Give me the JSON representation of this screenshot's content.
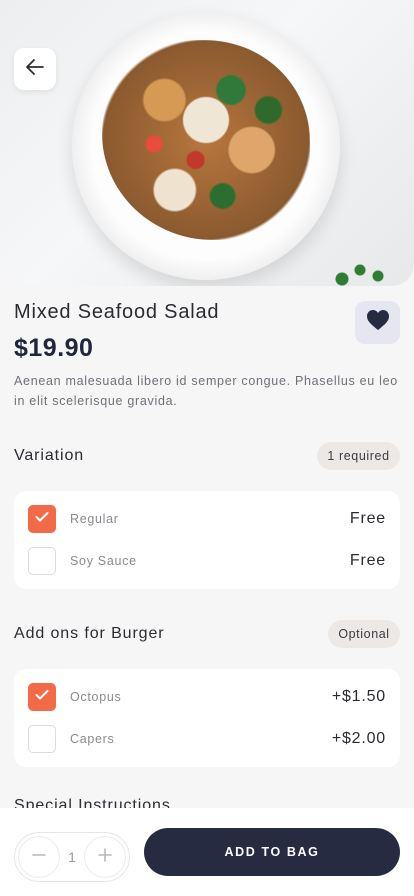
{
  "product": {
    "title": "Mixed Seafood Salad",
    "price": "$19.90",
    "description": "Aenean malesuada libero id semper congue. Phasellus eu leo in elit scelerisque gravida."
  },
  "variation": {
    "title": "Variation",
    "badge": "1 required",
    "options": [
      {
        "label": "Regular",
        "price": "Free",
        "checked": true
      },
      {
        "label": "Soy Sauce",
        "price": "Free",
        "checked": false
      }
    ]
  },
  "addons": {
    "title": "Add ons for Burger",
    "badge": "Optional",
    "options": [
      {
        "label": "Octopus",
        "price": "+$1.50",
        "checked": true
      },
      {
        "label": "Capers",
        "price": "+$2.00",
        "checked": false
      }
    ]
  },
  "special": {
    "title": "Special Instructions"
  },
  "cart": {
    "quantity": "1",
    "add_label": "ADD TO BAG"
  },
  "colors": {
    "accent": "#f26a47",
    "primary": "#272b42"
  }
}
